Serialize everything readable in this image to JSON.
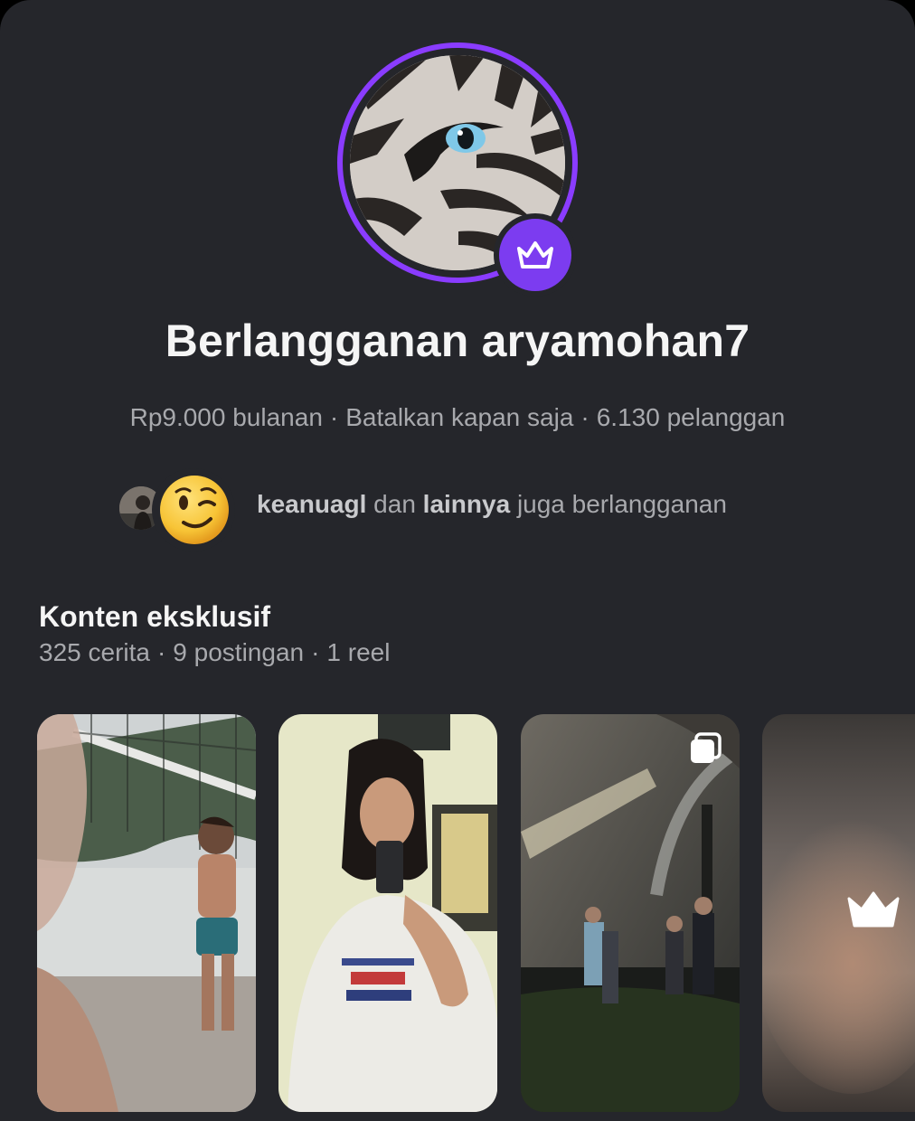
{
  "subscription": {
    "title": "Berlangganan aryamohan7",
    "price": "Rp9.000 bulanan",
    "separator": "·",
    "cancel_text": "Batalkan kapan saja",
    "subscriber_count": "6.130 pelanggan"
  },
  "mutual": {
    "user1": "keanuagl",
    "connector": "dan",
    "others": "lainnya",
    "suffix": "juga berlangganan"
  },
  "exclusive": {
    "heading": "Konten eksklusif",
    "stories": "325 cerita",
    "posts": "9 postingan",
    "reels": "1 reel",
    "separator": "·"
  },
  "icons": {
    "badge": "crown-icon",
    "multi": "carousel-icon",
    "locked": "crown-icon"
  },
  "colors": {
    "background": "#25262b",
    "accent": "#8a3cff",
    "text_primary": "#f5f5f5",
    "text_secondary": "#a8a9ad"
  }
}
